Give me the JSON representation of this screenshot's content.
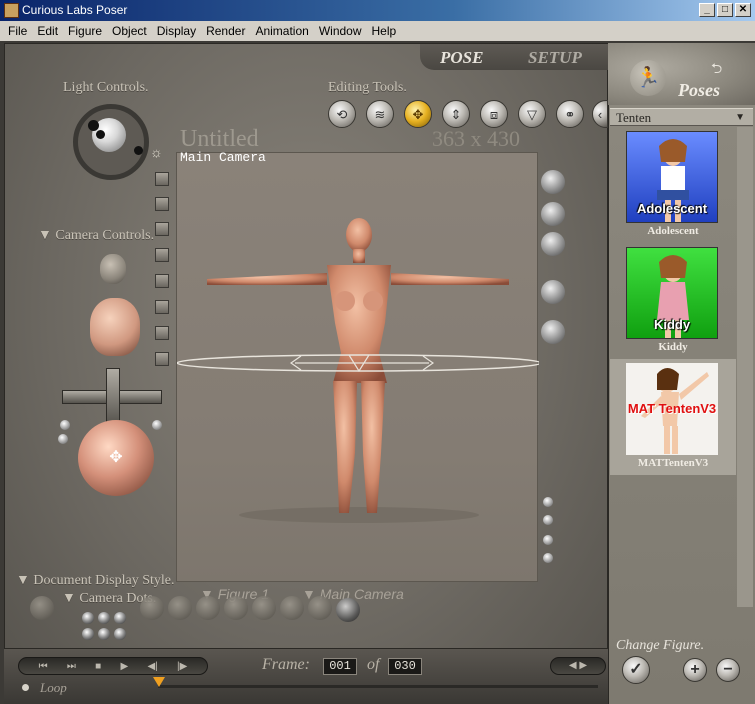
{
  "window": {
    "title": "Curious Labs Poser",
    "minimize": "_",
    "maximize": "□",
    "close": "✕"
  },
  "menu": [
    "File",
    "Edit",
    "Figure",
    "Object",
    "Display",
    "Render",
    "Animation",
    "Window",
    "Help"
  ],
  "tabs": {
    "pose": "POSE",
    "setup": "SETUP"
  },
  "labels": {
    "light_controls": "Light Controls.",
    "editing_tools": "Editing Tools.",
    "camera_controls": "Camera Controls.",
    "document_display_style": "Document Display Style.",
    "camera_dots": "Camera Dots.",
    "figure": "Figure 1",
    "main_camera_select": "Main Camera"
  },
  "document": {
    "title": "Untitled",
    "size": "363 x 430",
    "camera": "Main Camera"
  },
  "timeline": {
    "frame_label": "Frame:",
    "current_frame": "001",
    "of_label": "of",
    "total_frames": "030",
    "loop_label": "Loop",
    "marker_position": 0.0
  },
  "library": {
    "title": "Poses",
    "category": "Tenten",
    "items": [
      {
        "thumb_text": "Adolescent",
        "name": "Adolescent",
        "bg": "#3a5fd0",
        "text_color": "#ffffff",
        "selected": false
      },
      {
        "thumb_text": "Kiddy",
        "name": "Kiddy",
        "bg": "#2bcc2b",
        "text_color": "#ffffff",
        "selected": false
      },
      {
        "thumb_text": "MAT TentenV3",
        "name": "MATTentenV3",
        "bg": "#f4f2ee",
        "text_color": "#e01010",
        "selected": true
      }
    ],
    "change_figure": "Change Figure.",
    "check_button": "✓",
    "add_button": "+",
    "remove_button": "−"
  },
  "icons": {
    "tool_rotate": "⟲",
    "tool_twist": "≋",
    "tool_translate": "✥",
    "tool_translate_z": "⇕",
    "tool_scale": "⧈",
    "tool_taper": "▽",
    "tool_chain": "⚭",
    "tool_more": "‹",
    "sun": "☼",
    "poses_figure": "🏃",
    "sphere_arrows": "✥",
    "transport": [
      "⏮",
      "⏭",
      "■",
      "▶",
      "◀|",
      "|▶"
    ],
    "transport_right": "◀ ▶",
    "collapse": "▼"
  },
  "colors": {
    "active_tool": "#e6b020",
    "timeline_marker": "#f0a020"
  }
}
